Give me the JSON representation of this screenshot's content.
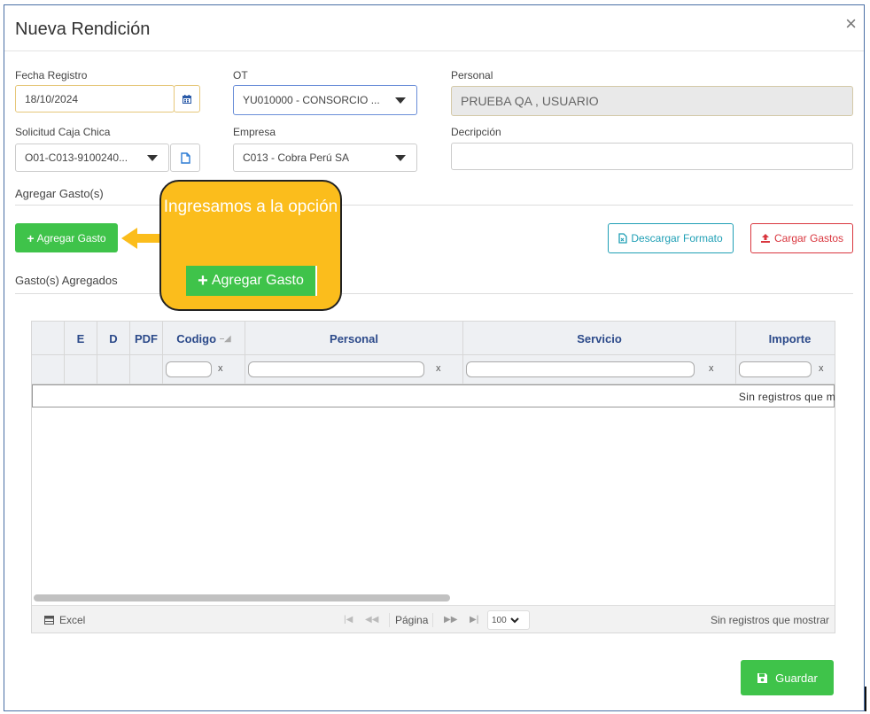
{
  "modal": {
    "title": "Nueva Rendición",
    "close_label": "×"
  },
  "form": {
    "fecha_label": "Fecha Registro",
    "fecha_value": "18/10/2024",
    "ot_label": "OT",
    "ot_value": "YU010000 - CONSORCIO ...",
    "personal_label": "Personal",
    "personal_value": "PRUEBA QA , USUARIO",
    "solicitud_label": "Solicitud Caja Chica",
    "solicitud_value": "O01-C013-9100240...",
    "empresa_label": "Empresa",
    "empresa_value": "C013 - Cobra Perú SA",
    "descripcion_label": "Decripción",
    "descripcion_value": ""
  },
  "sections": {
    "agregar": "Agregar Gasto(s)",
    "agregados": "Gasto(s) Agregados"
  },
  "buttons": {
    "agregar_gasto": "Agregar Gasto",
    "descargar_formato": "Descargar Formato",
    "cargar_gastos": "Cargar Gastos",
    "guardar": "Guardar"
  },
  "callout": {
    "text": "Ingresamos a la opción",
    "button_label": "Agregar Gasto"
  },
  "grid": {
    "columns": [
      "E",
      "D",
      "PDF",
      "Codigo",
      "Personal",
      "Servicio",
      "Importe"
    ],
    "empty_message": "Sin registros que m",
    "filter_clear": "x"
  },
  "pager": {
    "excel": "Excel",
    "page_label": "Página",
    "page_size": "100",
    "status": "Sin registros que mostrar"
  },
  "colors": {
    "primary_green": "#3fc34a",
    "callout": "#fbbd1c",
    "teal": "#1f9fb5",
    "red": "#d9363e",
    "header_text": "#2c4a8a"
  }
}
